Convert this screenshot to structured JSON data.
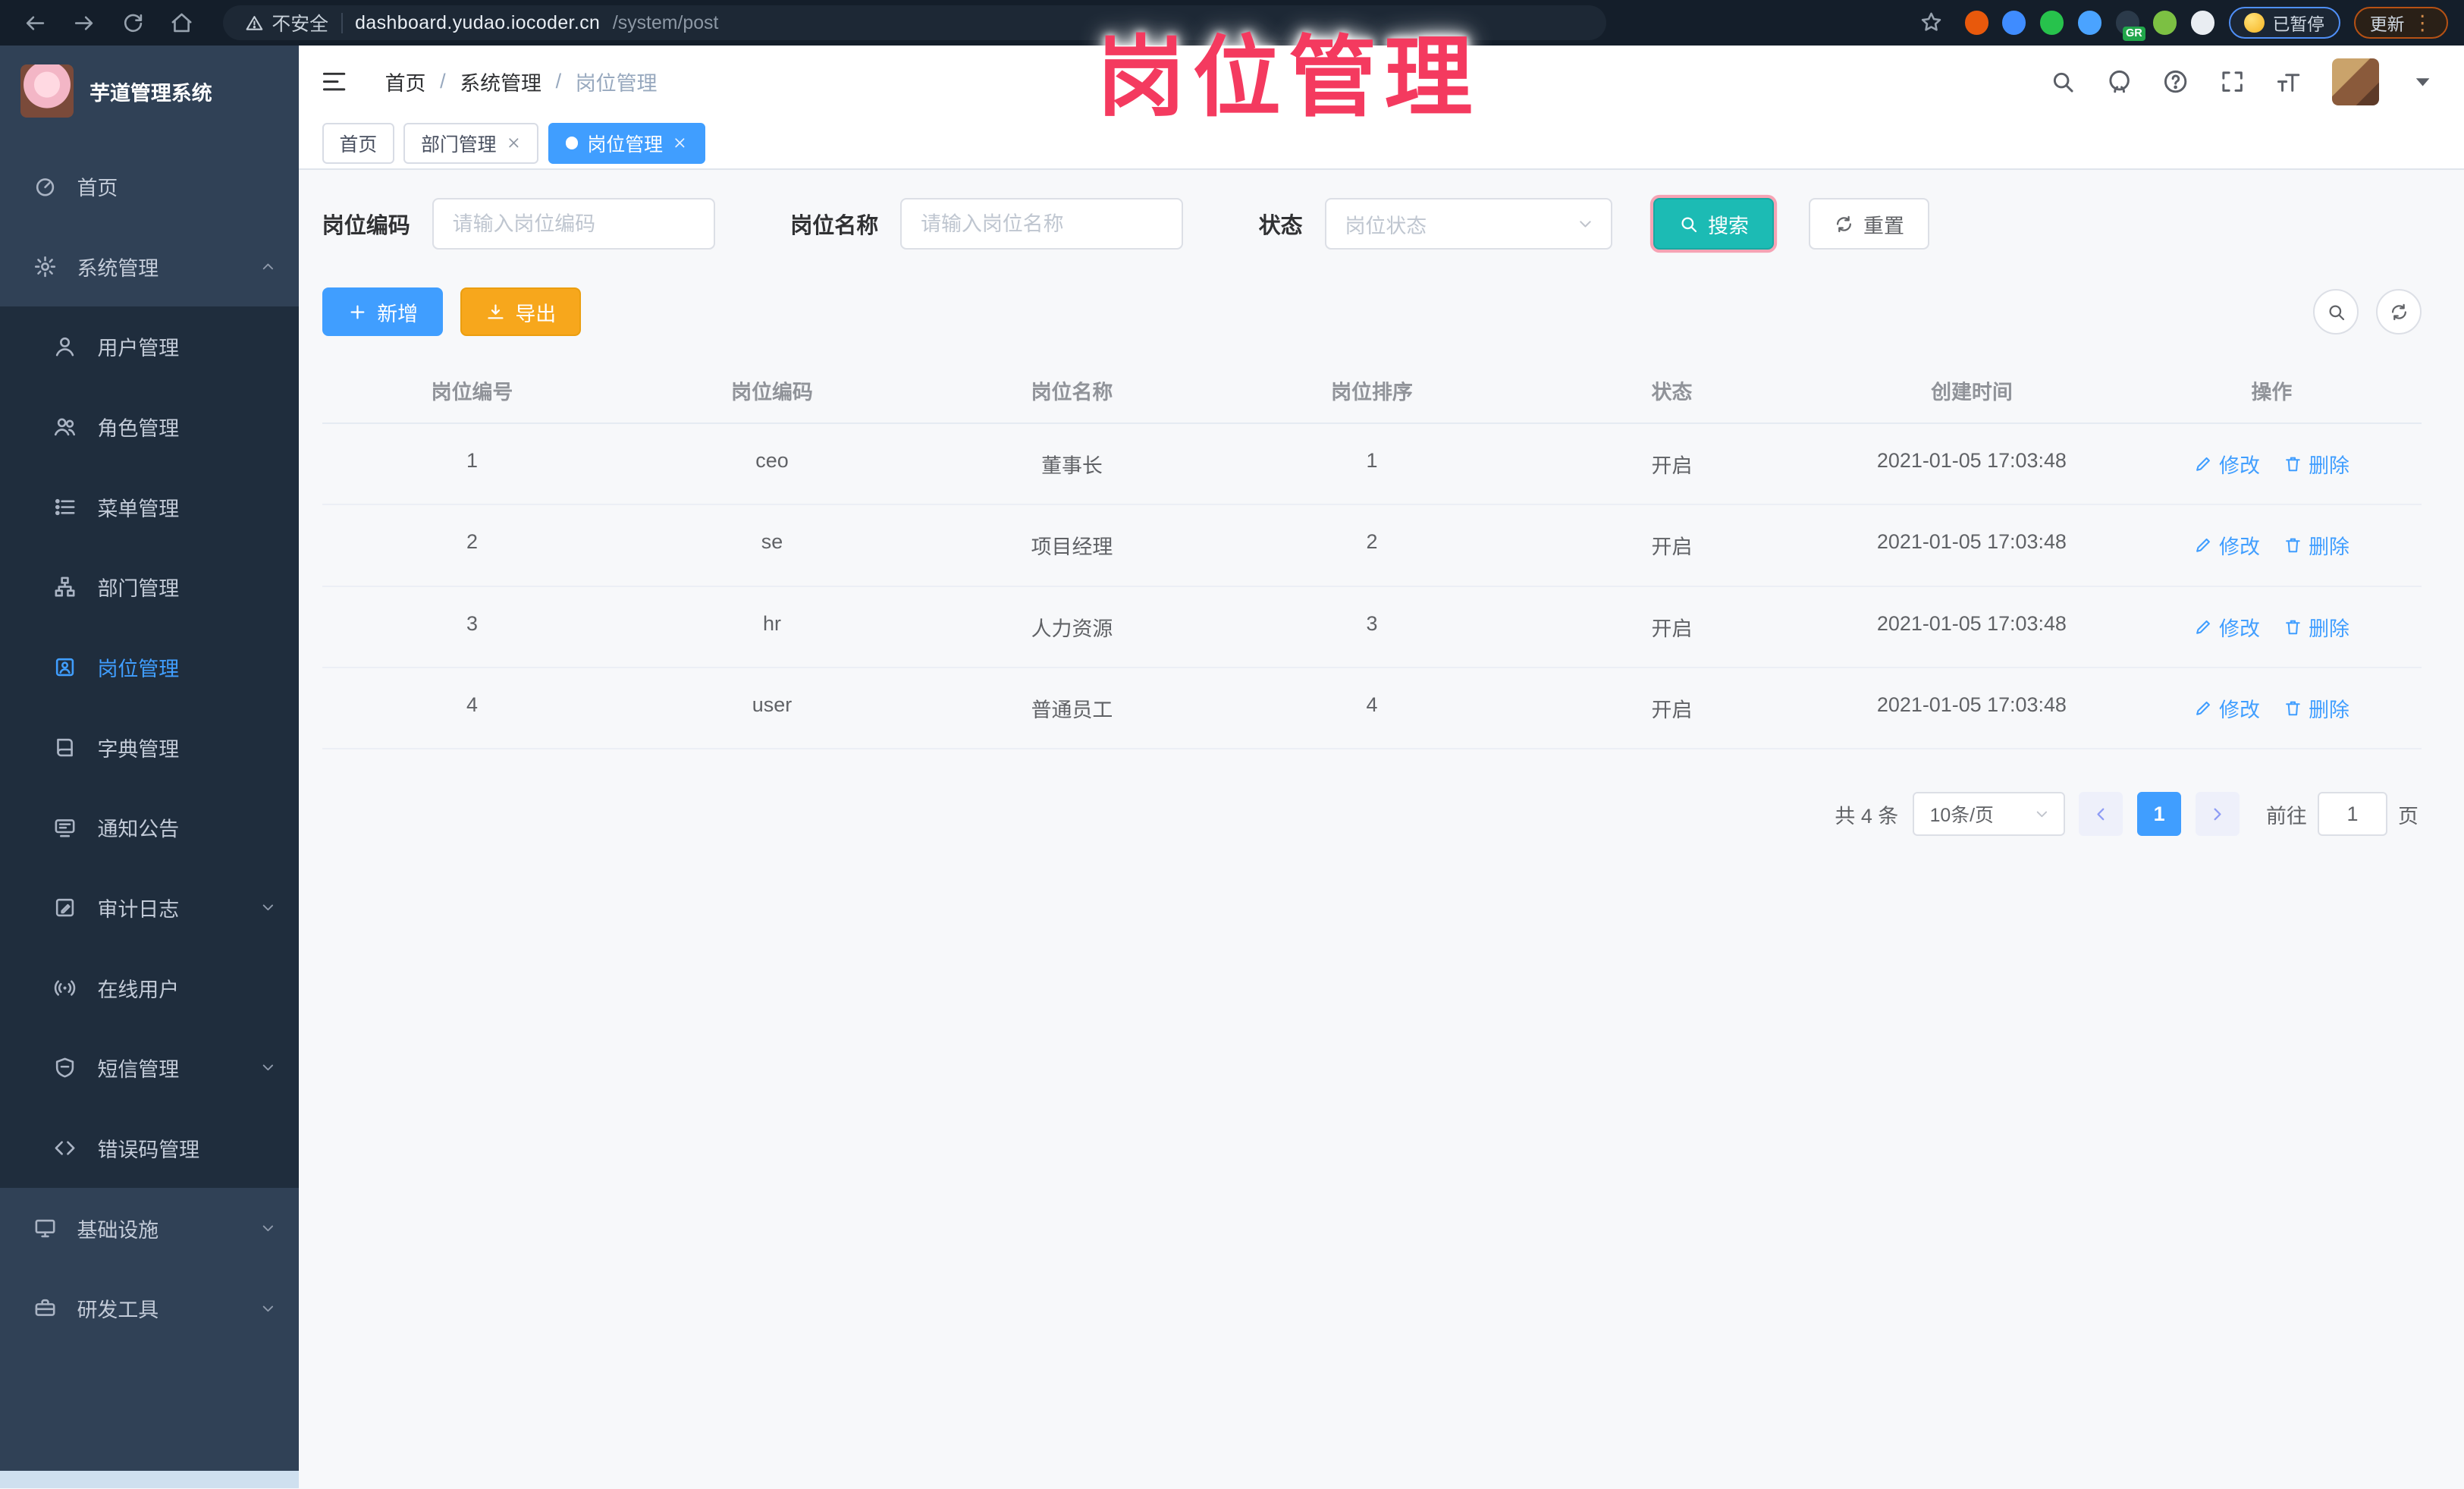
{
  "overlay": {
    "title": "岗位管理",
    "color": "#f43a5f"
  },
  "browser": {
    "nav_icons": [
      "back-icon",
      "forward-icon",
      "reload-icon",
      "home-icon"
    ],
    "insecure_label": "不安全",
    "url_host": "dashboard.yudao.iocoder.cn",
    "url_path": "/system/post",
    "extensions": [
      {
        "name": "extension-orange-icon",
        "color": "#e8590c"
      },
      {
        "name": "extension-pin-icon",
        "color": "#3f8cff"
      },
      {
        "name": "extension-green-check-icon",
        "color": "#27c24c"
      },
      {
        "name": "extension-settings-icon",
        "color": "#4aa3ff"
      },
      {
        "name": "extension-gr-icon",
        "color": "#2b3a4a",
        "badge": "GR"
      },
      {
        "name": "extension-plant-icon",
        "color": "#7cc043"
      },
      {
        "name": "extensions-puzzle-icon",
        "color": "#e9edf2"
      }
    ],
    "paused_label": "已暂停",
    "update_label": "更新"
  },
  "sidebar": {
    "app_title": "芋道管理系统",
    "items": [
      {
        "id": "home",
        "label": "首页",
        "icon": "dashboard-icon",
        "type": "top"
      },
      {
        "id": "system-management",
        "label": "系统管理",
        "icon": "gear-icon",
        "type": "top",
        "arrow": "chevron-up"
      },
      {
        "id": "user-management",
        "label": "用户管理",
        "icon": "user-icon",
        "type": "sub"
      },
      {
        "id": "role-management",
        "label": "角色管理",
        "icon": "users-icon",
        "type": "sub"
      },
      {
        "id": "menu-management",
        "label": "菜单管理",
        "icon": "list-icon",
        "type": "sub"
      },
      {
        "id": "dept-management",
        "label": "部门管理",
        "icon": "org-tree-icon",
        "type": "sub"
      },
      {
        "id": "post-management",
        "label": "岗位管理",
        "icon": "badge-icon",
        "type": "sub",
        "active": true
      },
      {
        "id": "dict-management",
        "label": "字典管理",
        "icon": "book-icon",
        "type": "sub"
      },
      {
        "id": "notice-announcement",
        "label": "通知公告",
        "icon": "announcement-icon",
        "type": "sub"
      },
      {
        "id": "audit-log",
        "label": "审计日志",
        "icon": "edit-square-icon",
        "type": "sub",
        "arrow": "chevron-down"
      },
      {
        "id": "online-users",
        "label": "在线用户",
        "icon": "broadcast-icon",
        "type": "sub"
      },
      {
        "id": "sms-management",
        "label": "短信管理",
        "icon": "shield-message-icon",
        "type": "sub",
        "arrow": "chevron-down"
      },
      {
        "id": "error-code-management",
        "label": "错误码管理",
        "icon": "code-icon",
        "type": "sub"
      },
      {
        "id": "infrastructure",
        "label": "基础设施",
        "icon": "monitor-icon",
        "type": "top",
        "arrow": "chevron-down"
      },
      {
        "id": "dev-tools",
        "label": "研发工具",
        "icon": "toolbox-icon",
        "type": "top",
        "arrow": "chevron-down"
      }
    ]
  },
  "header": {
    "breadcrumb": [
      "首页",
      "系统管理",
      "岗位管理"
    ],
    "tool_icons": [
      "search-icon",
      "github-icon",
      "question-icon",
      "fullscreen-icon",
      "fontsize-icon"
    ]
  },
  "tabs": [
    {
      "label": "首页",
      "closable": false,
      "active": false
    },
    {
      "label": "部门管理",
      "closable": true,
      "active": false
    },
    {
      "label": "岗位管理",
      "closable": true,
      "active": true
    }
  ],
  "filters": {
    "code_label": "岗位编码",
    "code_placeholder": "请输入岗位编码",
    "name_label": "岗位名称",
    "name_placeholder": "请输入岗位名称",
    "status_label": "状态",
    "status_placeholder": "岗位状态",
    "search_label": "搜索",
    "reset_label": "重置"
  },
  "toolbar": {
    "add_label": "新增",
    "export_label": "导出",
    "right_icons": [
      "search-icon",
      "refresh-icon"
    ]
  },
  "table": {
    "columns": [
      "岗位编号",
      "岗位编码",
      "岗位名称",
      "岗位排序",
      "状态",
      "创建时间",
      "操作"
    ],
    "rows": [
      {
        "cells": [
          "1",
          "ceo",
          "董事长",
          "1",
          "开启",
          "2021-01-05 17:03:48"
        ]
      },
      {
        "cells": [
          "2",
          "se",
          "项目经理",
          "2",
          "开启",
          "2021-01-05 17:03:48"
        ]
      },
      {
        "cells": [
          "3",
          "hr",
          "人力资源",
          "3",
          "开启",
          "2021-01-05 17:03:48"
        ]
      },
      {
        "cells": [
          "4",
          "user",
          "普通员工",
          "4",
          "开启",
          "2021-01-05 17:03:48"
        ]
      }
    ],
    "actions": {
      "edit": "修改",
      "delete": "删除"
    }
  },
  "pagination": {
    "total_text": "共 4 条",
    "page_size": "10条/页",
    "current_page": "1",
    "goto_label": "前往",
    "goto_value": "1",
    "page_unit": "页"
  },
  "colors": {
    "accent": "#409EFF",
    "search_teal": "#1cbbb4",
    "export_orange": "#f7a71c",
    "sidebar_bg": "#304156",
    "submenu_bg": "#1f2d3d"
  }
}
